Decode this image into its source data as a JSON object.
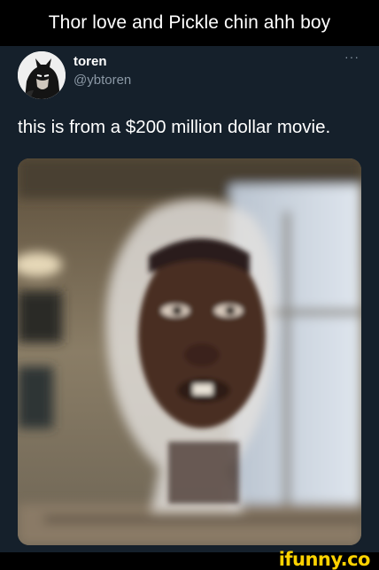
{
  "meme": {
    "caption": "Thor love and Pickle chin ahh boy"
  },
  "tweet": {
    "display_name": "toren",
    "handle": "@ybtoren",
    "more_label": "···",
    "text": "this is from a $200 million dollar movie."
  },
  "watermark": {
    "text": "ifunny.co"
  },
  "icons": {
    "more": "more-options-icon",
    "avatar": "batman-avatar-icon"
  },
  "colors": {
    "tweet_background": "#15202b",
    "primary_text": "#ffffff",
    "secondary_text": "#8b98a5",
    "watermark": "#ffd200"
  }
}
